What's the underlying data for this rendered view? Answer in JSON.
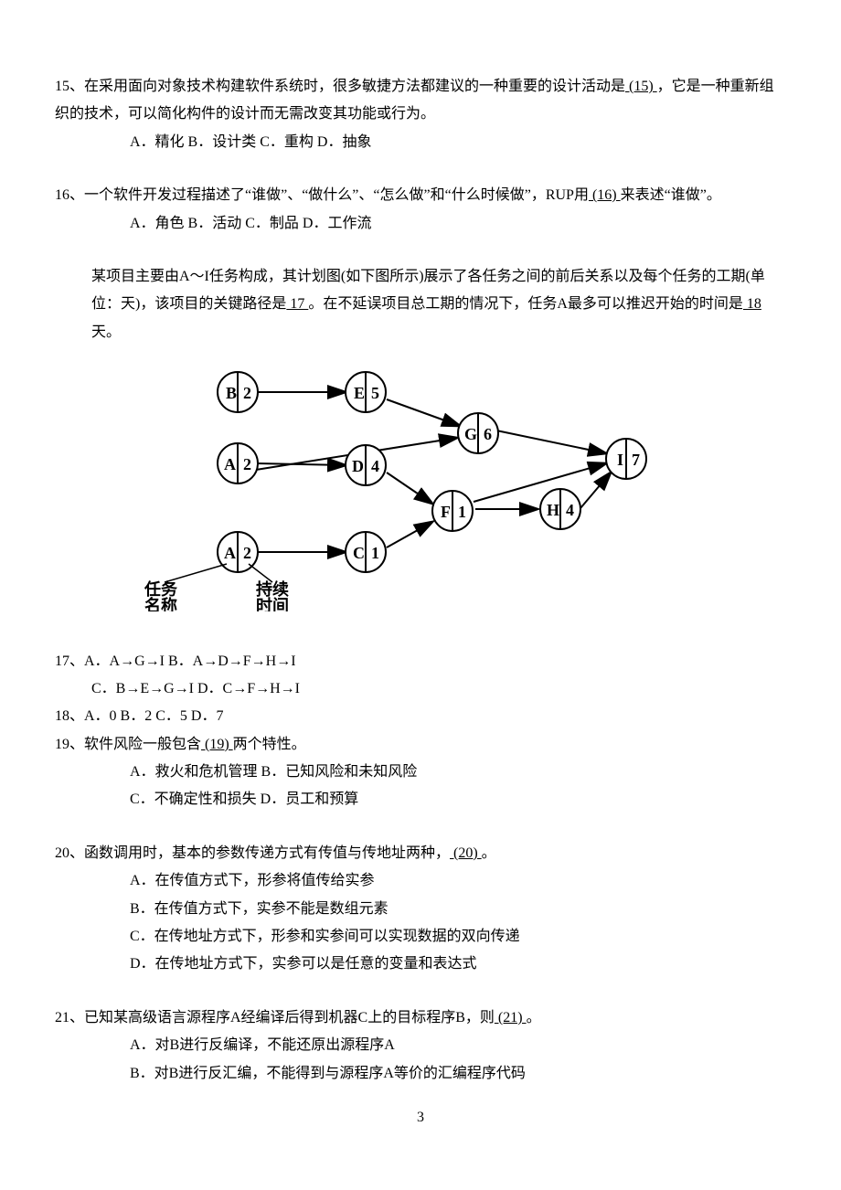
{
  "q15": {
    "text_a": "15、在采用面向对象技术构建软件系统时，很多敏捷方法都建议的一种重要的设计活动是",
    "blank": "   (15)   ",
    "text_b": "，它是一种重新组织的技术，可以简化构件的设计而无需改变其功能或行为。",
    "opts": "A．精化        B．设计类        C．重构        D．抽象"
  },
  "q16": {
    "text_a": "16、一个软件开发过程描述了“谁做”、“做什么”、“怎么做”和“什么时候做”，RUP用",
    "blank": "   (16)   ",
    "text_b": "来表述“谁做”。",
    "opts": "A．角色        B．活动        C．制品        D．工作流"
  },
  "intro1718": {
    "text_a": "某项目主要由A～I任务构成，其计划图(如下图所示)展示了各任务之间的前后关系以及每个任务的工期(单位：天)，该项目的关键路径是",
    "blank1": "   17   ",
    "text_b": "。在不延误项目总工期的情况下，任务A最多可以推迟开始的时间是",
    "blank2": "   18   ",
    "text_c": "天。"
  },
  "diagram": {
    "nodes": {
      "B": "B",
      "Bv": "2",
      "E": "E",
      "Ev": "5",
      "G": "G",
      "Gv": "6",
      "A1": "A",
      "A1v": "2",
      "D": "D",
      "Dv": "4",
      "I": "I",
      "Iv": "7",
      "A2": "A",
      "A2v": "2",
      "C": "C",
      "Cv": "1",
      "F": "F",
      "Fv": "1",
      "H": "H",
      "Hv": "4"
    },
    "label_task": "任务",
    "label_name": "名称",
    "label_hold": "持续",
    "label_time": "时间"
  },
  "q17": {
    "line1": "17、A．A→G→I        B．A→D→F→H→I",
    "line2": "C．B→E→G→I        D．C→F→H→I"
  },
  "q18": {
    "line": "18、A．0        B．2        C．5        D．7"
  },
  "q19": {
    "text_a": "19、软件风险一般包含",
    "blank": "   (19)   ",
    "text_b": "两个特性。",
    "line1": "A．救火和危机管理        B．已知风险和未知风险",
    "line2": "C．不确定性和损失        D．员工和预算"
  },
  "q20": {
    "text_a": "20、函数调用时，基本的参数传递方式有传值与传地址两种，",
    "blank": "   (20)   ",
    "text_b": "。",
    "optA": "A．在传值方式下，形参将值传给实参",
    "optB": "B．在传值方式下，实参不能是数组元素",
    "optC": "C．在传地址方式下，形参和实参间可以实现数据的双向传递",
    "optD": "D．在传地址方式下，实参可以是任意的变量和表达式"
  },
  "q21": {
    "text_a": "21、已知某高级语言源程序A经编译后得到机器C上的目标程序B，则",
    "blank": "   (21)   ",
    "text_b": "。",
    "optA": "A．对B进行反编译，不能还原出源程序A",
    "optB": "B．对B进行反汇编，不能得到与源程序A等价的汇编程序代码"
  },
  "page_num": "3"
}
